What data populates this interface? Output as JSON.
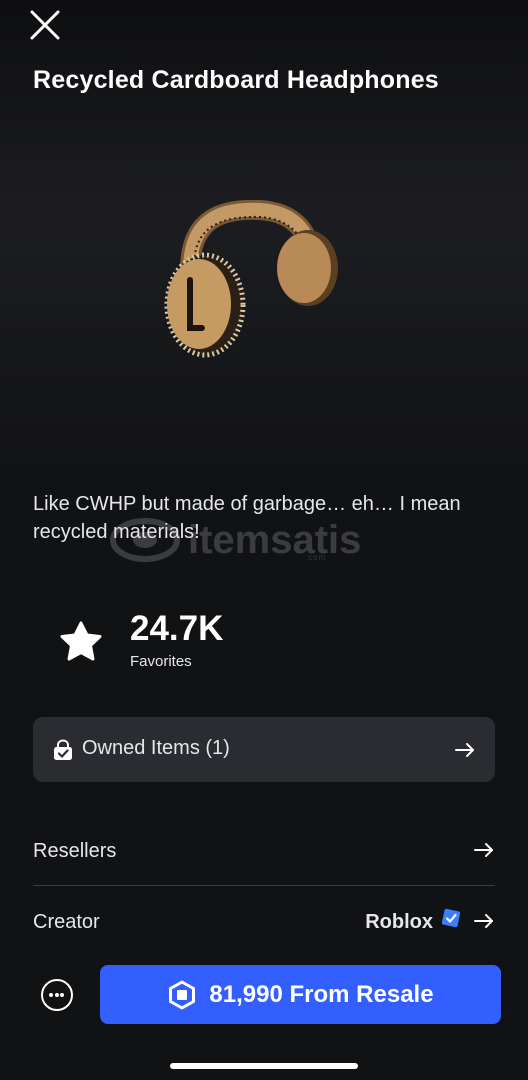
{
  "item": {
    "title": "Recycled Cardboard Headphones",
    "description": "Like CWHP but made of garbage… eh… I mean recycled materials!"
  },
  "watermark": {
    "brand": "itemsatis",
    "small": ".com"
  },
  "favorites": {
    "count": "24.7K",
    "label": "Favorites"
  },
  "owned": {
    "label": "Owned Items (1)"
  },
  "resellers": {
    "label": "Resellers"
  },
  "creator": {
    "label": "Creator",
    "name": "Roblox"
  },
  "purchase": {
    "label": "81,990 From Resale"
  },
  "colors": {
    "accent": "#335fff",
    "background": "#111214",
    "card": "#2a2c31"
  },
  "icons": [
    "close-icon",
    "star-icon",
    "shopping-bag-check-icon",
    "arrow-right-icon",
    "verified-badge-icon",
    "more-icon",
    "robux-icon"
  ]
}
